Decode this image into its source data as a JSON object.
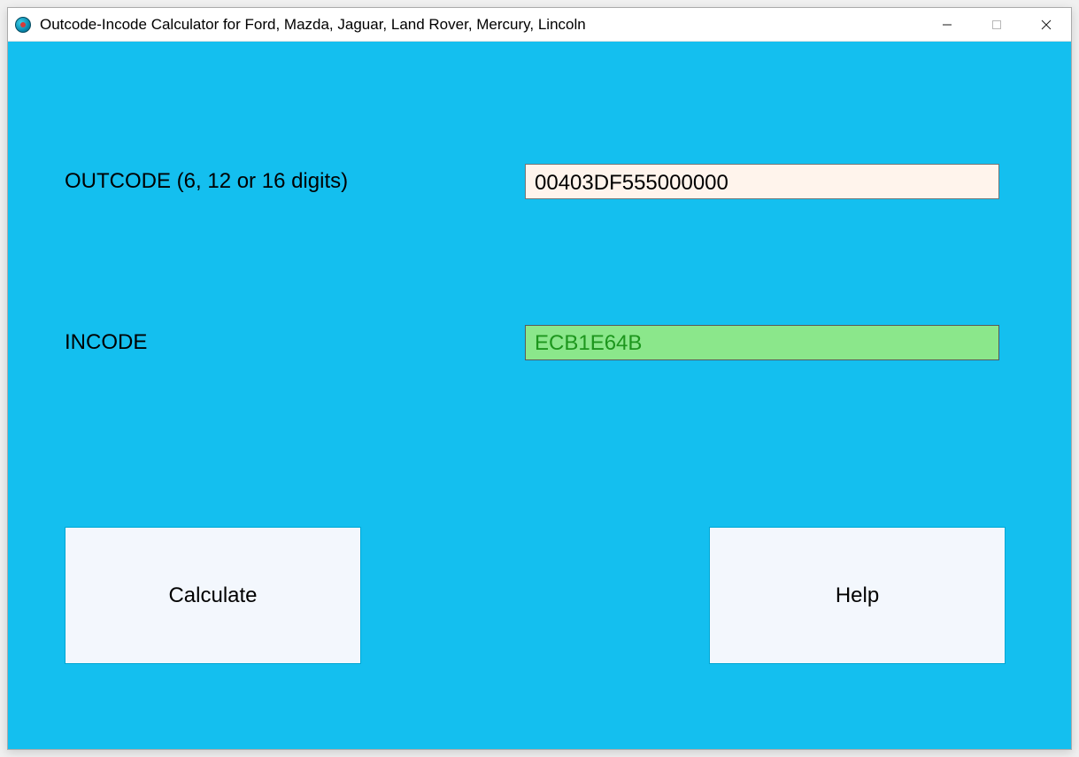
{
  "window": {
    "title": "Outcode-Incode Calculator for Ford, Mazda, Jaguar, Land Rover, Mercury, Lincoln"
  },
  "fields": {
    "outcode": {
      "label": "OUTCODE (6, 12 or 16 digits)",
      "value": "00403DF555000000"
    },
    "incode": {
      "label": "INCODE",
      "value": "ECB1E64B"
    }
  },
  "buttons": {
    "calculate": "Calculate",
    "help": "Help"
  }
}
